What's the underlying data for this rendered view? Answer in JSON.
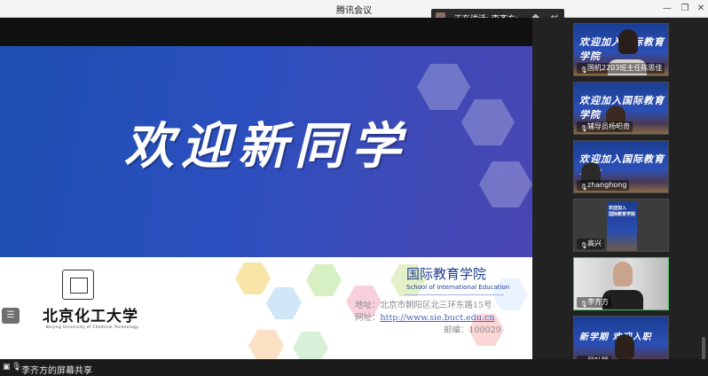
{
  "window": {
    "title": "腾讯会议",
    "controls": [
      "—",
      "❐",
      "✕"
    ]
  },
  "speaking": {
    "label": "正在讲话: 李齐方;"
  },
  "slide": {
    "greeting": "欢迎新同学",
    "university_cn": "北京化工大学",
    "university_en": "Beijing University of Chemical Technology",
    "school_cn": "国际教育学院",
    "school_en": "School of International Education",
    "address": "地址：北京市朝阳区北三环东路15号",
    "website_label": "网址：",
    "website": "http://www.sie.buct.edu.cn",
    "postcode": "邮编：100029"
  },
  "participants": [
    {
      "name": "国机2203班主任陈思佳",
      "banner": "欢迎加入国际教育学院"
    },
    {
      "name": "辅导员杨昭奇",
      "banner": "欢迎加入国际教育学院"
    },
    {
      "name": "zhanghong",
      "banner": "欢迎加入国际教育学院"
    },
    {
      "name": "高兴",
      "banner": "欢迎加入国际教育学院"
    },
    {
      "name": "李齐方",
      "banner": ""
    },
    {
      "name": "吴叶颖",
      "banner": "新学期 欢迎入职"
    }
  ],
  "status": {
    "share_label": "李齐方的屏幕共享"
  },
  "colors": {
    "accent_green": "#46c06a",
    "slide_blue": "#2c4fbf",
    "school_blue": "#1f3f8f"
  }
}
